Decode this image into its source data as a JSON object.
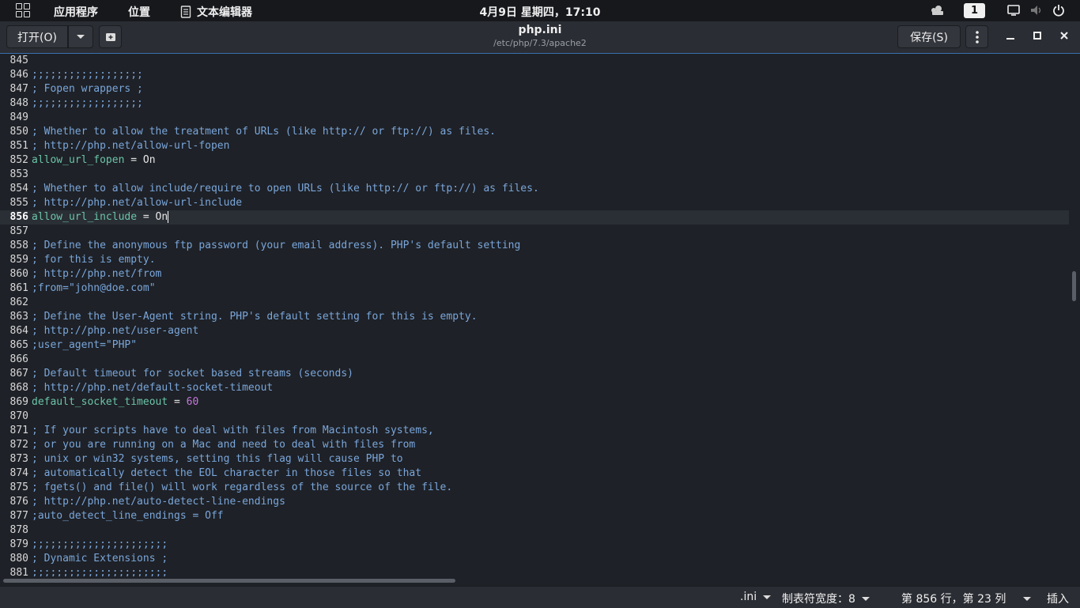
{
  "topbar": {
    "apps_label": "应用程序",
    "places_label": "位置",
    "editor_menu_label": "文本编辑器",
    "clock": "4月9日 星期四，17:10",
    "workspace": "1"
  },
  "header": {
    "open_label": "打开(O)",
    "save_label": "保存(S)",
    "title": "php.ini",
    "path": "/etc/php/7.3/apache2"
  },
  "editor": {
    "current_line": 856,
    "lines": [
      {
        "n": "845",
        "segments": []
      },
      {
        "n": "846",
        "segments": [
          {
            "t": ";;;;;;;;;;;;;;;;;;",
            "c": "cm"
          }
        ]
      },
      {
        "n": "847",
        "segments": [
          {
            "t": "; Fopen wrappers ;",
            "c": "cm"
          }
        ]
      },
      {
        "n": "848",
        "segments": [
          {
            "t": ";;;;;;;;;;;;;;;;;;",
            "c": "cm"
          }
        ]
      },
      {
        "n": "849",
        "segments": []
      },
      {
        "n": "850",
        "segments": [
          {
            "t": "; Whether to allow the treatment of URLs (like http:// or ftp://) as files.",
            "c": "cm"
          }
        ]
      },
      {
        "n": "851",
        "segments": [
          {
            "t": "; http://php.net/allow-url-fopen",
            "c": "cm"
          }
        ]
      },
      {
        "n": "852",
        "segments": [
          {
            "t": "allow_url_fopen",
            "c": "key"
          },
          {
            "t": " = On",
            "c": ""
          }
        ]
      },
      {
        "n": "853",
        "segments": []
      },
      {
        "n": "854",
        "segments": [
          {
            "t": "; Whether to allow include/require to open URLs (like http:// or ftp://) as files.",
            "c": "cm"
          }
        ]
      },
      {
        "n": "855",
        "segments": [
          {
            "t": "; http://php.net/allow-url-include",
            "c": "cm"
          }
        ]
      },
      {
        "n": "856",
        "segments": [
          {
            "t": "allow_url_include",
            "c": "key"
          },
          {
            "t": " = On",
            "c": ""
          }
        ]
      },
      {
        "n": "857",
        "segments": []
      },
      {
        "n": "858",
        "segments": [
          {
            "t": "; Define the anonymous ftp password (your email address). PHP's default setting",
            "c": "cm"
          }
        ]
      },
      {
        "n": "859",
        "segments": [
          {
            "t": "; for this is empty.",
            "c": "cm"
          }
        ]
      },
      {
        "n": "860",
        "segments": [
          {
            "t": "; http://php.net/from",
            "c": "cm"
          }
        ]
      },
      {
        "n": "861",
        "segments": [
          {
            "t": ";from=\"john@doe.com\"",
            "c": "cm"
          }
        ]
      },
      {
        "n": "862",
        "segments": []
      },
      {
        "n": "863",
        "segments": [
          {
            "t": "; Define the User-Agent string. PHP's default setting for this is empty.",
            "c": "cm"
          }
        ]
      },
      {
        "n": "864",
        "segments": [
          {
            "t": "; http://php.net/user-agent",
            "c": "cm"
          }
        ]
      },
      {
        "n": "865",
        "segments": [
          {
            "t": ";user_agent=\"PHP\"",
            "c": "cm"
          }
        ]
      },
      {
        "n": "866",
        "segments": []
      },
      {
        "n": "867",
        "segments": [
          {
            "t": "; Default timeout for socket based streams (seconds)",
            "c": "cm"
          }
        ]
      },
      {
        "n": "868",
        "segments": [
          {
            "t": "; http://php.net/default-socket-timeout",
            "c": "cm"
          }
        ]
      },
      {
        "n": "869",
        "segments": [
          {
            "t": "default_socket_timeout",
            "c": "key"
          },
          {
            "t": " = ",
            "c": ""
          },
          {
            "t": "60",
            "c": "num"
          }
        ]
      },
      {
        "n": "870",
        "segments": []
      },
      {
        "n": "871",
        "segments": [
          {
            "t": "; If your scripts have to deal with files from Macintosh systems,",
            "c": "cm"
          }
        ]
      },
      {
        "n": "872",
        "segments": [
          {
            "t": "; or you are running on a Mac and need to deal with files from",
            "c": "cm"
          }
        ]
      },
      {
        "n": "873",
        "segments": [
          {
            "t": "; unix or win32 systems, setting this flag will cause PHP to",
            "c": "cm"
          }
        ]
      },
      {
        "n": "874",
        "segments": [
          {
            "t": "; automatically detect the EOL character in those files so that",
            "c": "cm"
          }
        ]
      },
      {
        "n": "875",
        "segments": [
          {
            "t": "; fgets() and file() will work regardless of the source of the file.",
            "c": "cm"
          }
        ]
      },
      {
        "n": "876",
        "segments": [
          {
            "t": "; http://php.net/auto-detect-line-endings",
            "c": "cm"
          }
        ]
      },
      {
        "n": "877",
        "segments": [
          {
            "t": ";auto_detect_line_endings = Off",
            "c": "cm"
          }
        ]
      },
      {
        "n": "878",
        "segments": []
      },
      {
        "n": "879",
        "segments": [
          {
            "t": ";;;;;;;;;;;;;;;;;;;;;;",
            "c": "cm"
          }
        ]
      },
      {
        "n": "880",
        "segments": [
          {
            "t": "; Dynamic Extensions ;",
            "c": "cm"
          }
        ]
      },
      {
        "n": "881",
        "segments": [
          {
            "t": ";;;;;;;;;;;;;;;;;;;;;;",
            "c": "cm"
          }
        ]
      }
    ]
  },
  "statusbar": {
    "language": ".ini",
    "tab_width": "制表符宽度：8",
    "position": "第 856 行，第 23 列",
    "mode": "插入"
  },
  "colors": {
    "background": "#1e2127",
    "comment": "#7aa6da",
    "key": "#6bc4a8",
    "number": "#c678dd",
    "accent": "#3a6fb0"
  }
}
